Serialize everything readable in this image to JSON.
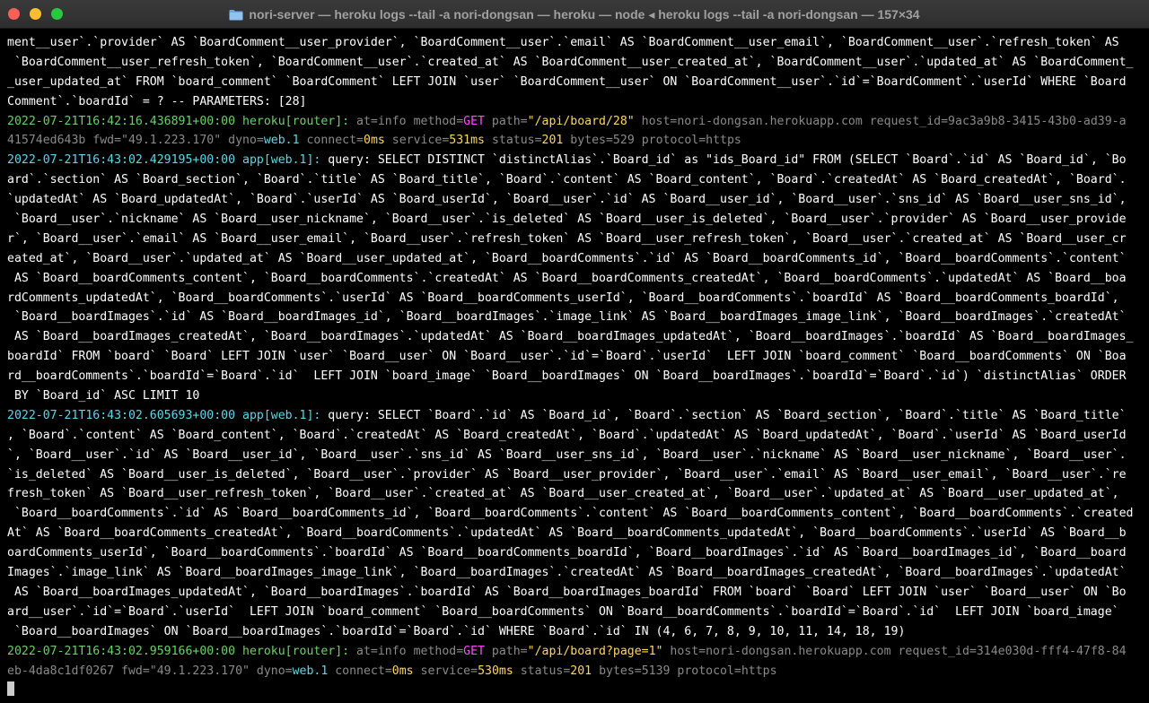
{
  "window": {
    "title": "nori-server — heroku logs --tail -a nori-dongsan — heroku — node ◂ heroku logs --tail -a nori-dongsan — 157×34",
    "title_icon": "folder-icon"
  },
  "colors": {
    "timestamp_router": "#6ad16a",
    "timestamp_app": "#5fd7e6",
    "meta": "#8a8a8a",
    "method": "#ff4dff",
    "value": "#ffd75f"
  },
  "terminal": {
    "lines": [
      [
        {
          "t": "ment__user`.`provider` AS `BoardComment__user_provider`, `BoardComment__user`.`email` AS `BoardComment__user_email`, `BoardComment__user`.`refresh_token` AS"
        }
      ],
      [
        {
          "t": " `BoardComment__user_refresh_token`, `BoardComment__user`.`created_at` AS `BoardComment__user_created_at`, `BoardComment__user`.`updated_at` AS `BoardComment_"
        }
      ],
      [
        {
          "t": "_user_updated_at` FROM `board_comment` `BoardComment` LEFT JOIN `user` `BoardComment__user` ON `BoardComment__user`.`id`=`BoardComment`.`userId` WHERE `Board"
        }
      ],
      [
        {
          "t": "Comment`.`boardId` = ? -- PARAMETERS: [28]"
        }
      ],
      [
        {
          "t": "2022-07-21T16:42:16.436891+00:00 heroku[router]:",
          "c": "green"
        },
        {
          "t": " at=info method=",
          "c": "dim"
        },
        {
          "t": "GET",
          "c": "magenta"
        },
        {
          "t": " path=",
          "c": "dim"
        },
        {
          "t": "\"/api/board/28\"",
          "c": "yellow"
        },
        {
          "t": " host=nori-dongsan.herokuapp.com request_id=9ac3a9b8-3415-43b0-ad39-a",
          "c": "dim"
        }
      ],
      [
        {
          "t": "41574ed643b fwd=\"49.1.223.170\" dyno=",
          "c": "dim"
        },
        {
          "t": "web.1",
          "c": "cyan"
        },
        {
          "t": " connect=",
          "c": "dim"
        },
        {
          "t": "0ms",
          "c": "yellow"
        },
        {
          "t": " service=",
          "c": "dim"
        },
        {
          "t": "531ms",
          "c": "yellow"
        },
        {
          "t": " status=",
          "c": "dim"
        },
        {
          "t": "201",
          "c": "yellow"
        },
        {
          "t": " bytes=529 protocol=https",
          "c": "dim"
        }
      ],
      [
        {
          "t": "2022-07-21T16:43:02.429195+00:00 app[web.1]:",
          "c": "cyan"
        },
        {
          "t": " query: SELECT DISTINCT `distinctAlias`.`Board_id` as \"ids_Board_id\" FROM (SELECT `Board`.`id` AS `Board_id`, `Bo"
        }
      ],
      [
        {
          "t": "ard`.`section` AS `Board_section`, `Board`.`title` AS `Board_title`, `Board`.`content` AS `Board_content`, `Board`.`createdAt` AS `Board_createdAt`, `Board`."
        }
      ],
      [
        {
          "t": "`updatedAt` AS `Board_updatedAt`, `Board`.`userId` AS `Board_userId`, `Board__user`.`id` AS `Board__user_id`, `Board__user`.`sns_id` AS `Board__user_sns_id`,"
        }
      ],
      [
        {
          "t": " `Board__user`.`nickname` AS `Board__user_nickname`, `Board__user`.`is_deleted` AS `Board__user_is_deleted`, `Board__user`.`provider` AS `Board__user_provide"
        }
      ],
      [
        {
          "t": "r`, `Board__user`.`email` AS `Board__user_email`, `Board__user`.`refresh_token` AS `Board__user_refresh_token`, `Board__user`.`created_at` AS `Board__user_cr"
        }
      ],
      [
        {
          "t": "eated_at`, `Board__user`.`updated_at` AS `Board__user_updated_at`, `Board__boardComments`.`id` AS `Board__boardComments_id`, `Board__boardComments`.`content`"
        }
      ],
      [
        {
          "t": " AS `Board__boardComments_content`, `Board__boardComments`.`createdAt` AS `Board__boardComments_createdAt`, `Board__boardComments`.`updatedAt` AS `Board__boa"
        }
      ],
      [
        {
          "t": "rdComments_updatedAt`, `Board__boardComments`.`userId` AS `Board__boardComments_userId`, `Board__boardComments`.`boardId` AS `Board__boardComments_boardId`,"
        }
      ],
      [
        {
          "t": " `Board__boardImages`.`id` AS `Board__boardImages_id`, `Board__boardImages`.`image_link` AS `Board__boardImages_image_link`, `Board__boardImages`.`createdAt`"
        }
      ],
      [
        {
          "t": " AS `Board__boardImages_createdAt`, `Board__boardImages`.`updatedAt` AS `Board__boardImages_updatedAt`, `Board__boardImages`.`boardId` AS `Board__boardImages_"
        }
      ],
      [
        {
          "t": "boardId` FROM `board` `Board` LEFT JOIN `user` `Board__user` ON `Board__user`.`id`=`Board`.`userId`  LEFT JOIN `board_comment` `Board__boardComments` ON `Boa"
        }
      ],
      [
        {
          "t": "rd__boardComments`.`boardId`=`Board`.`id`  LEFT JOIN `board_image` `Board__boardImages` ON `Board__boardImages`.`boardId`=`Board`.`id`) `distinctAlias` ORDER"
        }
      ],
      [
        {
          "t": " BY `Board_id` ASC LIMIT 10"
        }
      ],
      [
        {
          "t": "2022-07-21T16:43:02.605693+00:00 app[web.1]:",
          "c": "cyan"
        },
        {
          "t": " query: SELECT `Board`.`id` AS `Board_id`, `Board`.`section` AS `Board_section`, `Board`.`title` AS `Board_title`"
        }
      ],
      [
        {
          "t": ", `Board`.`content` AS `Board_content`, `Board`.`createdAt` AS `Board_createdAt`, `Board`.`updatedAt` AS `Board_updatedAt`, `Board`.`userId` AS `Board_userId"
        }
      ],
      [
        {
          "t": "`, `Board__user`.`id` AS `Board__user_id`, `Board__user`.`sns_id` AS `Board__user_sns_id`, `Board__user`.`nickname` AS `Board__user_nickname`, `Board__user`."
        }
      ],
      [
        {
          "t": "`is_deleted` AS `Board__user_is_deleted`, `Board__user`.`provider` AS `Board__user_provider`, `Board__user`.`email` AS `Board__user_email`, `Board__user`.`re"
        }
      ],
      [
        {
          "t": "fresh_token` AS `Board__user_refresh_token`, `Board__user`.`created_at` AS `Board__user_created_at`, `Board__user`.`updated_at` AS `Board__user_updated_at`,"
        }
      ],
      [
        {
          "t": " `Board__boardComments`.`id` AS `Board__boardComments_id`, `Board__boardComments`.`content` AS `Board__boardComments_content`, `Board__boardComments`.`created"
        }
      ],
      [
        {
          "t": "At` AS `Board__boardComments_createdAt`, `Board__boardComments`.`updatedAt` AS `Board__boardComments_updatedAt`, `Board__boardComments`.`userId` AS `Board__b"
        }
      ],
      [
        {
          "t": "oardComments_userId`, `Board__boardComments`.`boardId` AS `Board__boardComments_boardId`, `Board__boardImages`.`id` AS `Board__boardImages_id`, `Board__board"
        }
      ],
      [
        {
          "t": "Images`.`image_link` AS `Board__boardImages_image_link`, `Board__boardImages`.`createdAt` AS `Board__boardImages_createdAt`, `Board__boardImages`.`updatedAt`"
        }
      ],
      [
        {
          "t": " AS `Board__boardImages_updatedAt`, `Board__boardImages`.`boardId` AS `Board__boardImages_boardId` FROM `board` `Board` LEFT JOIN `user` `Board__user` ON `Bo"
        }
      ],
      [
        {
          "t": "ard__user`.`id`=`Board`.`userId`  LEFT JOIN `board_comment` `Board__boardComments` ON `Board__boardComments`.`boardId`=`Board`.`id`  LEFT JOIN `board_image`"
        }
      ],
      [
        {
          "t": " `Board__boardImages` ON `Board__boardImages`.`boardId`=`Board`.`id` WHERE `Board`.`id` IN (4, 6, 7, 8, 9, 10, 11, 14, 18, 19)"
        }
      ],
      [
        {
          "t": "2022-07-21T16:43:02.959166+00:00 heroku[router]:",
          "c": "green"
        },
        {
          "t": " at=info method=",
          "c": "dim"
        },
        {
          "t": "GET",
          "c": "magenta"
        },
        {
          "t": " path=",
          "c": "dim"
        },
        {
          "t": "\"/api/board?page=1\"",
          "c": "yellow"
        },
        {
          "t": " host=nori-dongsan.herokuapp.com request_id=314e030d-fff4-47f8-84",
          "c": "dim"
        }
      ],
      [
        {
          "t": "eb-4da8c1df0267 fwd=\"49.1.223.170\" dyno=",
          "c": "dim"
        },
        {
          "t": "web.1",
          "c": "cyan"
        },
        {
          "t": " connect=",
          "c": "dim"
        },
        {
          "t": "0ms",
          "c": "yellow"
        },
        {
          "t": " service=",
          "c": "dim"
        },
        {
          "t": "530ms",
          "c": "yellow"
        },
        {
          "t": " status=",
          "c": "dim"
        },
        {
          "t": "201",
          "c": "yellow"
        },
        {
          "t": " bytes=5139 protocol=https",
          "c": "dim"
        }
      ]
    ]
  }
}
